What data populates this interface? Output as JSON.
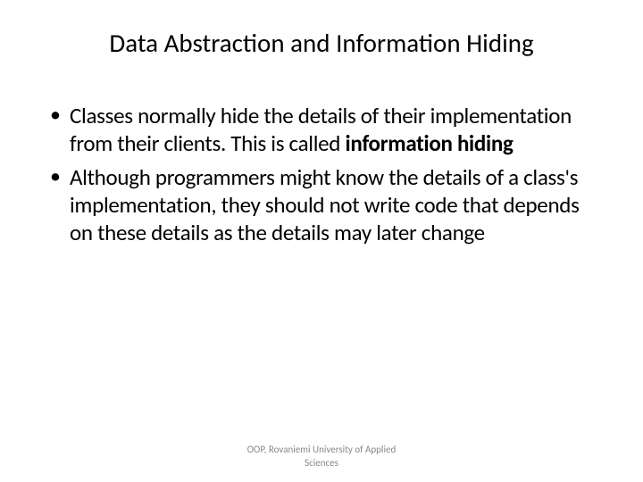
{
  "slide": {
    "title": "Data Abstraction and Information Hiding",
    "bullets": [
      {
        "prefix": "Classes normally hide the details of their implementation from their clients. This is called ",
        "bold": "information hiding",
        "suffix": ""
      },
      {
        "prefix": "Although programmers might know the details of a class's implementation, they should not write code that depends on these details as the details may later change",
        "bold": "",
        "suffix": ""
      }
    ],
    "footer_line1": "OOP, Rovaniemi University of Applied",
    "footer_line2": "Sciences"
  }
}
